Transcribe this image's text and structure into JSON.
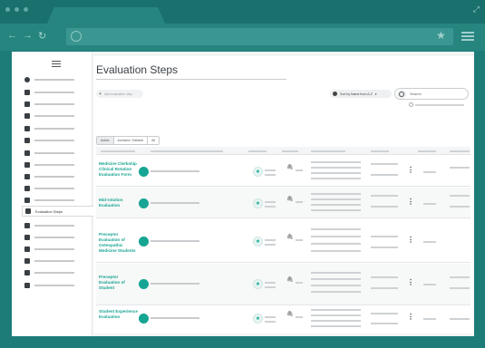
{
  "main": {
    "title": "Evaluation Steps",
    "add_button": "Add evaluation step",
    "sort_label": "Sort by Name from A-Z",
    "search_placeholder": "Search",
    "filters": [
      "Active",
      "Archived / Deleted",
      "All"
    ]
  },
  "sidebar": {
    "active_item": "Evaluation Steps"
  },
  "table": {
    "rows": [
      {
        "name": "Medicine Clerkship Clinical Rotation Evaluation Form"
      },
      {
        "name": "Mid-rotation Evaluation"
      },
      {
        "name": "Preceptor Evaluation of Osteopathic Medicine Students"
      },
      {
        "name": "Preceptor Evaluation of Student"
      },
      {
        "name": "Student Experience Evaluation"
      }
    ]
  },
  "colors": {
    "accent": "#15a592",
    "background": "#1d7b78"
  }
}
